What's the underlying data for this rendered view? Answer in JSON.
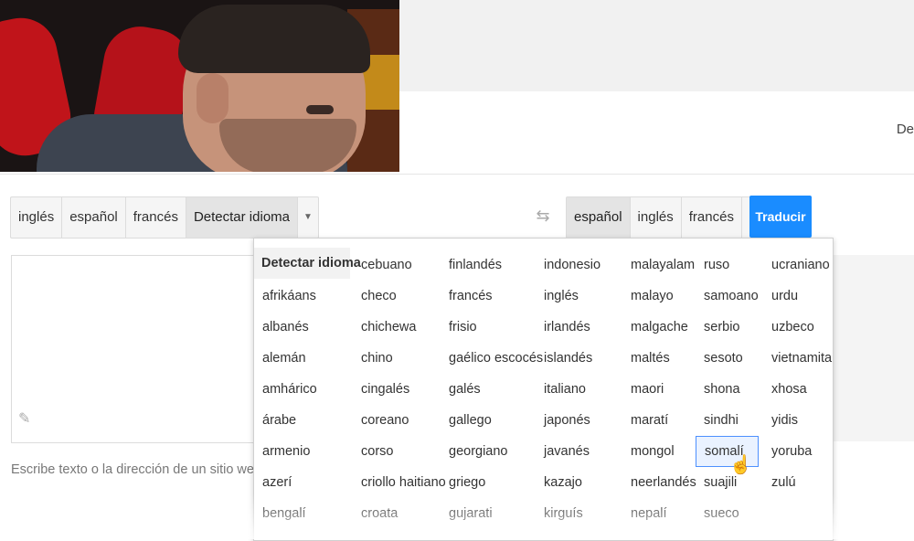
{
  "header": {
    "cut_text": "De"
  },
  "source_langs": {
    "tabs": [
      "inglés",
      "español",
      "francés",
      "Detectar idioma"
    ],
    "active_index": 3
  },
  "target_langs": {
    "tabs": [
      "español",
      "inglés",
      "francés"
    ],
    "active_index": 0
  },
  "translate_button": "Traducir",
  "hint": "Escribe texto o la dirección de un sitio web, o bie",
  "dropdown": {
    "detect": "Detectar idioma",
    "columns": [
      [
        "afrikáans",
        "albanés",
        "alemán",
        "amhárico",
        "árabe",
        "armenio",
        "azerí",
        "bengalí"
      ],
      [
        "cebuano",
        "checo",
        "chichewa",
        "chino",
        "cingalés",
        "coreano",
        "corso",
        "criollo haitiano",
        "croata"
      ],
      [
        "finlandés",
        "francés",
        "frisio",
        "gaélico escocés",
        "galés",
        "gallego",
        "georgiano",
        "griego",
        "gujarati"
      ],
      [
        "indonesio",
        "inglés",
        "irlandés",
        "islandés",
        "italiano",
        "japonés",
        "javanés",
        "kazajo",
        "kirguís"
      ],
      [
        "malayalam",
        "malayo",
        "malgache",
        "maltés",
        "maori",
        "maratí",
        "mongol",
        "neerlandés",
        "nepalí"
      ],
      [
        "ruso",
        "samoano",
        "serbio",
        "sesoto",
        "shona",
        "sindhi",
        "somalí",
        "suajili",
        "sueco"
      ],
      [
        "ucraniano",
        "urdu",
        "uzbeco",
        "vietnamita",
        "xhosa",
        "yidis",
        "yoruba",
        "zulú"
      ]
    ],
    "selected": "somalí"
  }
}
